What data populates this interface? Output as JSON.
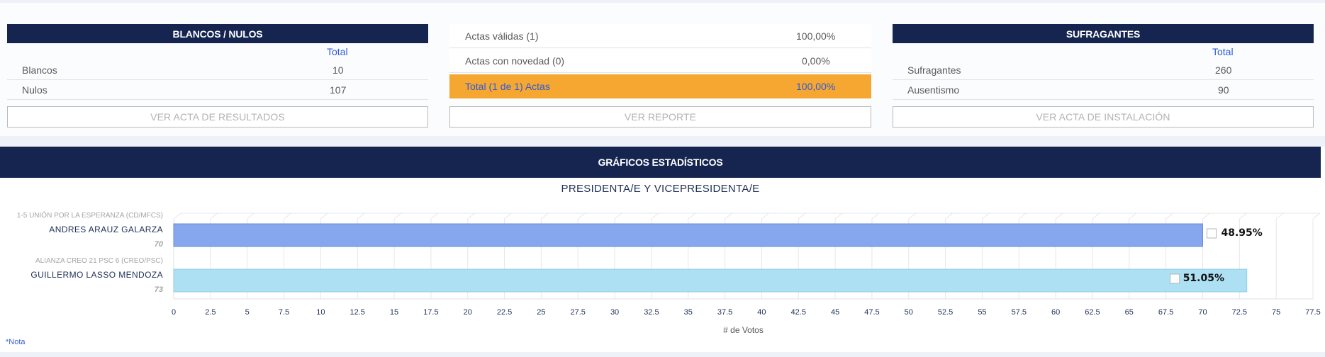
{
  "blancos_nulos": {
    "title": "BLANCOS / NULOS",
    "total_label": "Total",
    "rows": [
      {
        "label": "Blancos",
        "value": "10"
      },
      {
        "label": "Nulos",
        "value": "107"
      }
    ],
    "button": "VER ACTA DE RESULTADOS"
  },
  "actas": {
    "rows": [
      {
        "label": "Actas válidas (1)",
        "value": "100,00%"
      },
      {
        "label": "Actas con novedad (0)",
        "value": "0,00%"
      }
    ],
    "total": {
      "label": "Total (1 de 1) Actas",
      "value": "100,00%"
    },
    "button": "VER REPORTE",
    "highlight_color": "#f5a731"
  },
  "sufragantes": {
    "title": "SUFRAGANTES",
    "total_label": "Total",
    "rows": [
      {
        "label": "Sufragantes",
        "value": "260"
      },
      {
        "label": "Ausentismo",
        "value": "90"
      }
    ],
    "button": "VER ACTA DE INSTALACIÓN"
  },
  "graficos": {
    "title": "GRÁFICOS ESTADÍSTICOS",
    "note": "*Nota"
  },
  "chart_data": {
    "type": "bar",
    "orientation": "horizontal",
    "title": "PRESIDENTA/E Y VICEPRESIDENTA/E",
    "xlabel": "# de Votos",
    "xlim": [
      0,
      77.5
    ],
    "x_ticks": [
      "0",
      "2.5",
      "5",
      "7.5",
      "10",
      "12.5",
      "15",
      "17.5",
      "20",
      "22.5",
      "25",
      "27.5",
      "30",
      "32.5",
      "35",
      "37.5",
      "40",
      "42.5",
      "45",
      "47.5",
      "50",
      "52.5",
      "55",
      "57.5",
      "60",
      "62.5",
      "65",
      "67.5",
      "70",
      "72.5",
      "75",
      "77.5"
    ],
    "grid": true,
    "categories": [
      {
        "party": "1-5 UNIÓN POR LA ESPERANZA (CD/MFCS)",
        "candidate": "ANDRES ARAUZ GALARZA",
        "votes": 70,
        "votes_label": "70",
        "percent": "48.95%",
        "color": "#86a6ee"
      },
      {
        "party": "ALIANZA CREO 21 PSC 6 (CREO/PSC)",
        "candidate": "GUILLERMO LASSO MENDOZA",
        "votes": 73,
        "votes_label": "73",
        "percent": "51.05%",
        "color": "#ade0f2"
      }
    ]
  },
  "colors": {
    "header_bg": "#152550",
    "accent_blue": "#2e5cd6",
    "highlight": "#f5a731"
  }
}
